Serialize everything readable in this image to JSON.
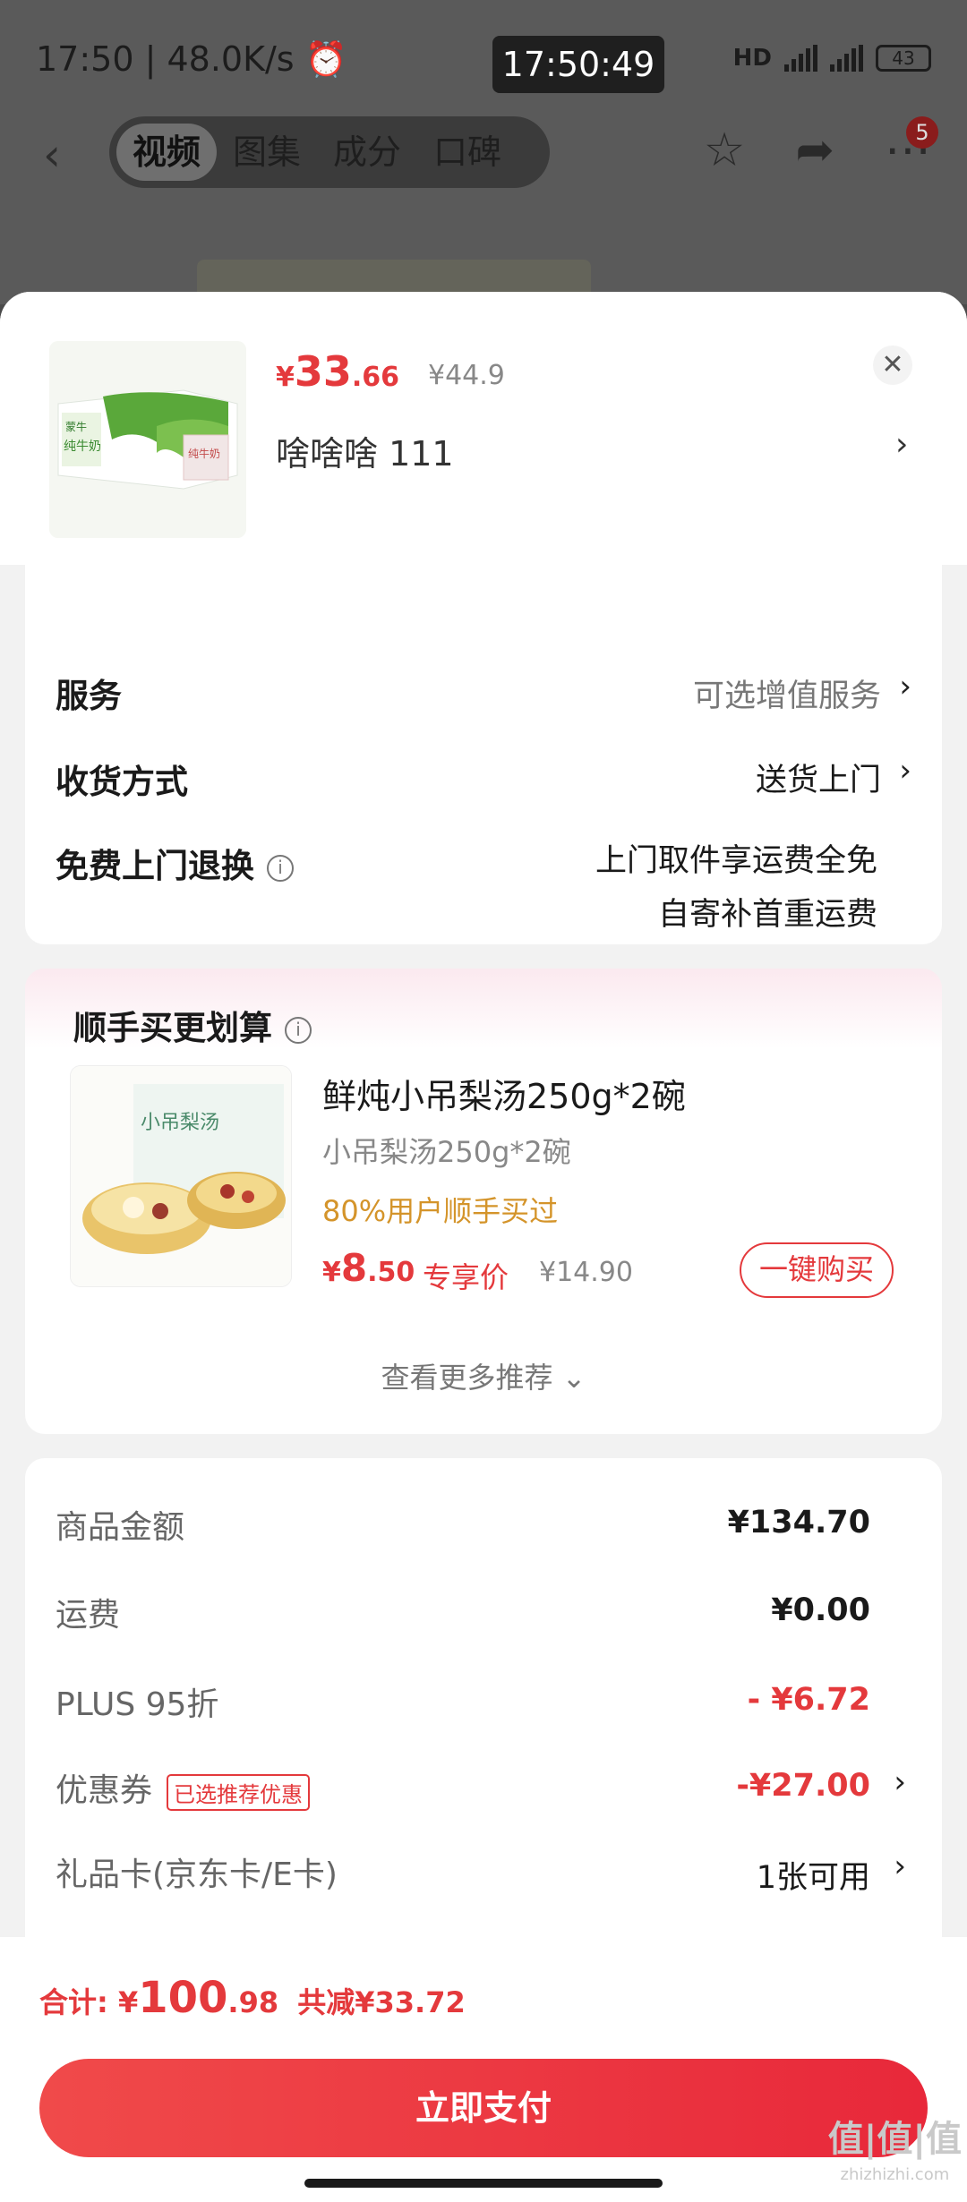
{
  "status_bar": {
    "time_speed": "17:50 | 48.0K/s ⏰",
    "clock": "17:50:49",
    "network": "HD 5G 5G",
    "battery": "43"
  },
  "nav": {
    "tabs": [
      "视频",
      "图集",
      "成分",
      "口碑"
    ],
    "badge_count": "5"
  },
  "product": {
    "price_symbol": "¥",
    "price_int": "33",
    "price_dec": ".66",
    "price_original": "¥44.9",
    "spec": "啥啥啥  111",
    "image_icon": "milk-box-image"
  },
  "services": {
    "service_label": "服务",
    "service_value": "可选增值服务",
    "delivery_label": "收货方式",
    "delivery_value": "送货上门",
    "return_label": "免费上门退换",
    "return_line1": "上门取件享运费全免",
    "return_line2": "自寄补首重运费"
  },
  "recommend": {
    "title": "顺手买更划算",
    "name": "鲜炖小吊梨汤250g*2碗",
    "sub": "小吊梨汤250g*2碗",
    "tag": "80%用户顺手买过",
    "price_symbol": "¥",
    "price_int": "8",
    "price_dec": ".50",
    "exclusive": "专享价",
    "price_old": "¥14.90",
    "buy_label": "一键购买",
    "more_label": "查看更多推荐 ⌄",
    "image_icon": "pear-soup-image"
  },
  "summary": {
    "goods_label": "商品金额",
    "goods_value": "¥134.70",
    "ship_label": "运费",
    "ship_value": "¥0.00",
    "plus_label": "PLUS 95折",
    "plus_value": "- ¥6.72",
    "coupon_label": "优惠券",
    "coupon_tag": "已选推荐优惠",
    "coupon_value": "-¥27.00",
    "gift_label": "礼品卡(京东卡/E卡)",
    "gift_value": "1张可用"
  },
  "footer": {
    "total_label": "合计: ",
    "total_symbol": "¥",
    "total_int": "100",
    "total_dec": ".98",
    "total_saved": "共减¥33.72",
    "pay_label": "立即支付",
    "watermark": "值|值|值",
    "watermark_site": "zhizhizhi.com"
  },
  "colors": {
    "accent": "#e4393c",
    "tag_orange": "#d4942a"
  }
}
